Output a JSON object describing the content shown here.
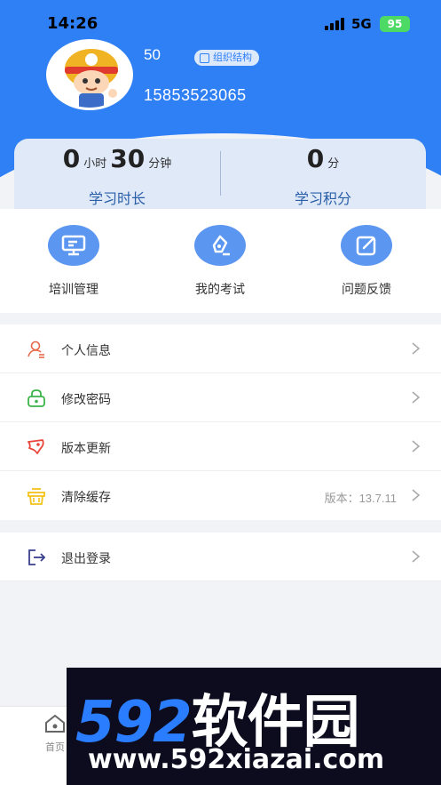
{
  "status_bar": {
    "time": "14:26",
    "network": "5G",
    "battery": "95"
  },
  "profile": {
    "name": "50",
    "org_badge": "组织结构",
    "phone": "15853523065"
  },
  "stats": {
    "study_time": {
      "hours": "0",
      "hours_unit": "小时",
      "minutes": "30",
      "minutes_unit": "分钟",
      "label": "学习时长"
    },
    "study_points": {
      "value": "0",
      "unit": "分",
      "label": "学习积分"
    }
  },
  "quick_actions": [
    {
      "label": "培训管理",
      "icon": "training-board-icon"
    },
    {
      "label": "我的考试",
      "icon": "exam-pen-icon"
    },
    {
      "label": "问题反馈",
      "icon": "feedback-edit-icon"
    }
  ],
  "menu": [
    {
      "label": "个人信息",
      "icon": "person-icon",
      "extra": ""
    },
    {
      "label": "修改密码",
      "icon": "lock-icon",
      "extra": ""
    },
    {
      "label": "版本更新",
      "icon": "rocket-icon",
      "extra": ""
    },
    {
      "label": "清除缓存",
      "icon": "basket-icon",
      "extra": "版本：13.7.11"
    }
  ],
  "logout": {
    "label": "退出登录",
    "icon": "logout-icon"
  },
  "tabbar": {
    "home_label": "首页"
  },
  "watermark": {
    "brand_num": "592",
    "brand_text": "软件园",
    "url": "www.592xiazai.com"
  },
  "colors": {
    "primary": "#2f7ff5",
    "icon_circle": "#5b96f0",
    "background": "#f2f3f7"
  }
}
